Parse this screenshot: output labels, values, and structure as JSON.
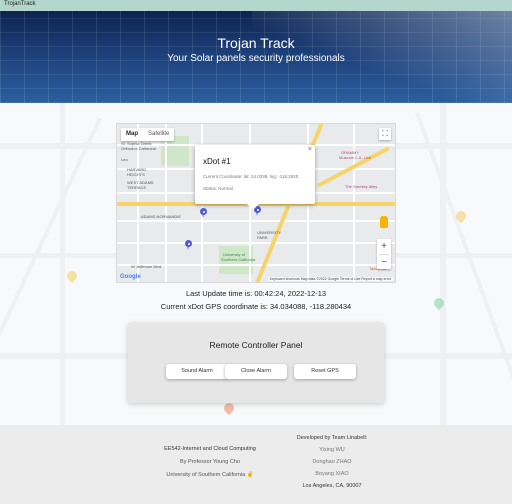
{
  "app": {
    "brand": "TrojanTrack"
  },
  "hero": {
    "title": "Trojan Track",
    "subtitle": "Your Solar panels security professionals"
  },
  "map": {
    "type_controls": [
      "Map",
      "Satellite"
    ],
    "labels": {
      "st_sophia": "St. Sophia Greek",
      "orthodox": "Orthodox Cathedral",
      "harvard_heights": "HARVARD",
      "harvard_heights2": "HEIGHTS",
      "west_adams": "WEST ADAMS",
      "west_adams2": "TERRACE",
      "adams_normandie": "ADAMS-NORMANDIE",
      "university_park": "UNIVERSITY",
      "university_park2": "PARK",
      "usc": "University of",
      "usc2": "Southern California",
      "grammy": "GRAMMY",
      "grammy2": "Museum L.A. Live",
      "broad": "The Sarmiey Alley",
      "tacos": "Tacos Gu",
      "jefferson": "W Jefferson Blvd",
      "leo": "Leo"
    },
    "infowindow": {
      "title": "xDot #1",
      "coord": "Current Coordinate: lat: 34.0338, lng: -118.2920",
      "status": "Status: Normal",
      "close": "×"
    },
    "google_logo": "Google",
    "attribution": "Keyboard shortcuts   Map data ©2022 Google   Terms of Use   Report a map error"
  },
  "status": {
    "update_time": "Last Update time is: 00:42:24, 2022-12-13",
    "gps": "Current xDot GPS coordinate is: 34.034088, -118.280434"
  },
  "panel": {
    "title": "Remote Controller Panel",
    "buttons": [
      "Sound Alarm",
      "Close Alarm",
      "Reset GPS"
    ]
  },
  "footer": {
    "left": [
      "EE542-Internet and Cloud Computing",
      "By Professor Young Cho",
      "University of Southern California ✌"
    ],
    "right_title": "Developed by Team Linabell:",
    "members": [
      "Yixing WU",
      "Donghao ZHAO",
      "Boyang XIAO"
    ],
    "address": "Los Angeles, CA, 90007"
  },
  "colors": {
    "topbar": "#b3d7cc",
    "hero": "#1c3f78",
    "pin": "#4f5bd5",
    "highway": "#f6d36b",
    "park": "#cfe7c8",
    "panel": "#e6e6e6",
    "footer": "#ececec"
  }
}
